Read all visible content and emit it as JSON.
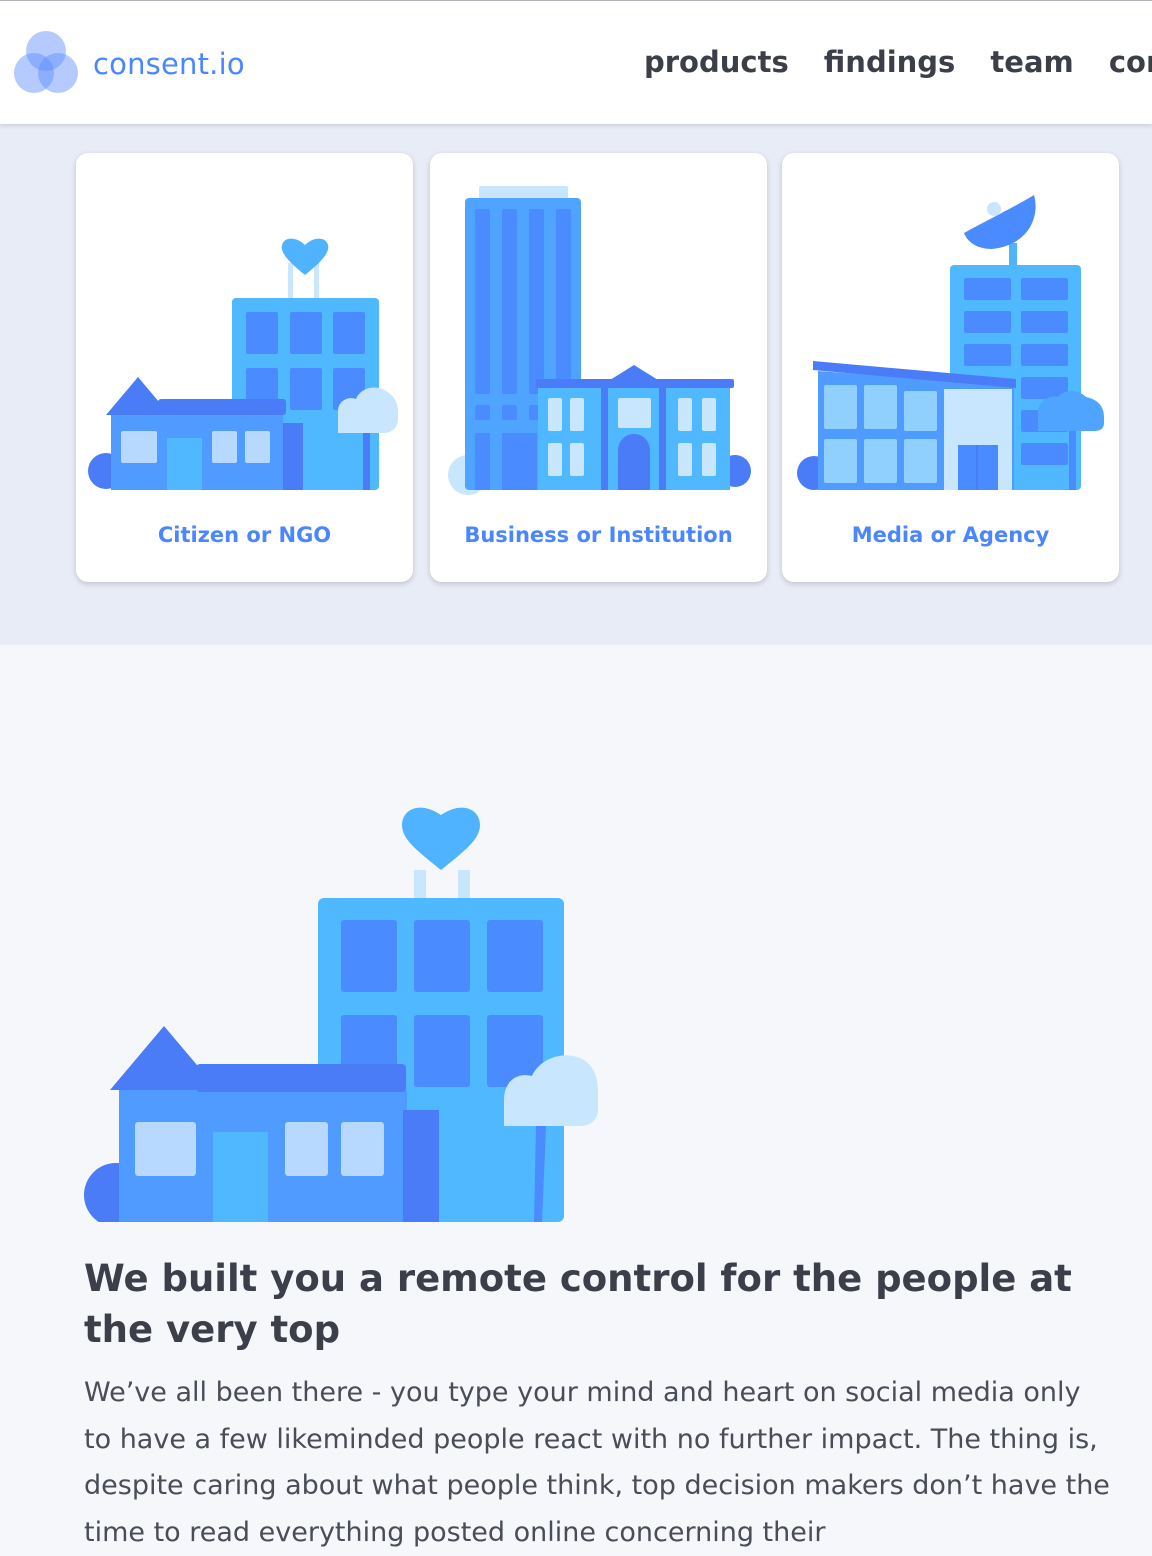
{
  "brand": {
    "name": "consent.io"
  },
  "nav": {
    "items": [
      {
        "label": "products"
      },
      {
        "label": "findings"
      },
      {
        "label": "team"
      },
      {
        "label": "contac"
      }
    ]
  },
  "cards": [
    {
      "label": "Citizen or NGO"
    },
    {
      "label": "Business or Institution"
    },
    {
      "label": "Media or Agency"
    }
  ],
  "main": {
    "headline": "We built you a remote control for the people at the very top",
    "paragraph": "We’ve all been there - you type your mind and heart on social media only to have a few likeminded people react with no further impact. The thing is, despite caring about what people think, top decision makers don’t have the time to read everything posted online concerning their"
  },
  "colors": {
    "accent": "#4a86ff",
    "band": "#e8ecf6",
    "page": "#f5f7fb",
    "heading": "#3c3f4a"
  }
}
